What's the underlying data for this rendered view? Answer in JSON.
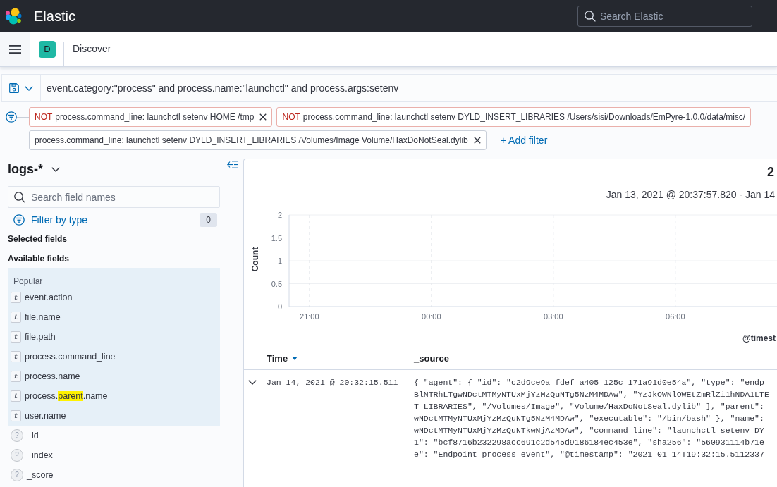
{
  "header": {
    "brand": "Elastic",
    "search": {
      "placeholder": "Search Elastic"
    }
  },
  "app_bar": {
    "space_initial": "D",
    "breadcrumb": "Discover"
  },
  "query_bar": {
    "query": "event.category:\"process\" and process.name:\"launchctl\" and process.args:setenv"
  },
  "filters": [
    {
      "negated": true,
      "prefix": "NOT",
      "text": "process.command_line: launchctl setenv HOME /tmp",
      "removable": true
    },
    {
      "negated": true,
      "prefix": "NOT",
      "text": "process.command_line: launchctl setenv DYLD_INSERT_LIBRARIES /Users/sisi/Downloads/EmPyre-1.0.0/data/misc/",
      "removable": false
    },
    {
      "negated": false,
      "text": "process.command_line: launchctl setenv DYLD_INSERT_LIBRARIES /Volumes/Image Volume/HaxDoNotSeal.dylib",
      "removable": true
    }
  ],
  "add_filter": "+ Add filter",
  "sidebar": {
    "index_pattern": "logs-*",
    "search": {
      "placeholder": "Search field names"
    },
    "filter_by_type": {
      "label": "Filter by type",
      "count": "0"
    },
    "selected_fields": {
      "title": "Selected fields"
    },
    "available_fields": {
      "title": "Available fields",
      "popular": {
        "title": "Popular",
        "fields": [
          {
            "kind": "string",
            "token": "t",
            "name": "event.action"
          },
          {
            "kind": "string",
            "token": "t",
            "name": "file.name"
          },
          {
            "kind": "string",
            "token": "t",
            "name": "file.path"
          },
          {
            "kind": "string",
            "token": "t",
            "name": "process.command_line"
          },
          {
            "kind": "string",
            "token": "t",
            "name": "process.name"
          },
          {
            "kind": "string",
            "token": "t",
            "name_parts": [
              {
                "text": "process.",
                "highlighted": false
              },
              {
                "text": "parent",
                "highlighted": true
              },
              {
                "text": ".name",
                "highlighted": false
              }
            ]
          },
          {
            "kind": "string",
            "token": "t",
            "name": "user.name"
          }
        ]
      },
      "fields": [
        {
          "kind": "unknown",
          "token": "?",
          "name": "_id"
        },
        {
          "kind": "unknown",
          "token": "?",
          "name": "_index"
        },
        {
          "kind": "unknown",
          "token": "?",
          "name": "_score"
        }
      ]
    }
  },
  "main": {
    "hits": "2",
    "time_range": "Jan 13, 2021 @ 20:37:57.820 - Jan 14",
    "chart_data": {
      "type": "bar",
      "xlabel": "@timest",
      "ylabel": "Count",
      "grid": true,
      "categories": [
        "21:00",
        null,
        null,
        "00:00",
        null,
        null,
        "03:00",
        null,
        null,
        "06:00",
        null,
        null
      ],
      "ylim": [
        0,
        2
      ],
      "yticks": [
        0,
        0.5,
        1,
        1.5,
        2
      ]
    }
  },
  "table": {
    "columns": [
      {
        "label": "Time",
        "sorted": true
      },
      {
        "label": "_source",
        "sorted": false
      }
    ],
    "rows": [
      {
        "expanded": true,
        "time": "Jan 14, 2021 @ 20:32:15.511",
        "source_lines": [
          "{ \"agent\": { \"id\": \"c2d9ce9a-fdef-a405-125c-171a91d0e54a\", \"type\": \"endp",
          "BlNTRhLTgwNDctMTMyNTUxMjYzMzQuNTg5NzM4MDAw\", \"YzJkOWNlOWEtZmRlZi1hNDA1LTE",
          "T_LIBRARIES\", \"/Volumes/Image\", \"Volume/HaxDoNotSeal.dylib\" ], \"parent\":",
          "wNDctMTMyNTUxMjYzMzQuNTg5NzM4MDAw\", \"executable\": \"/bin/bash\" }, \"name\":",
          "wNDctMTMyNTUxMjYzMzQuNTkwNjAzMDAw\", \"command_line\": \"launchctl setenv DY",
          "1\": \"bcf8716b232298acc691c2d545d9186184ec453e\", \"sha256\": \"560931114b71e",
          "e\": \"Endpoint process event\", \"@timestamp\": \"2021-01-14T19:32:15.5112337"
        ]
      }
    ]
  }
}
